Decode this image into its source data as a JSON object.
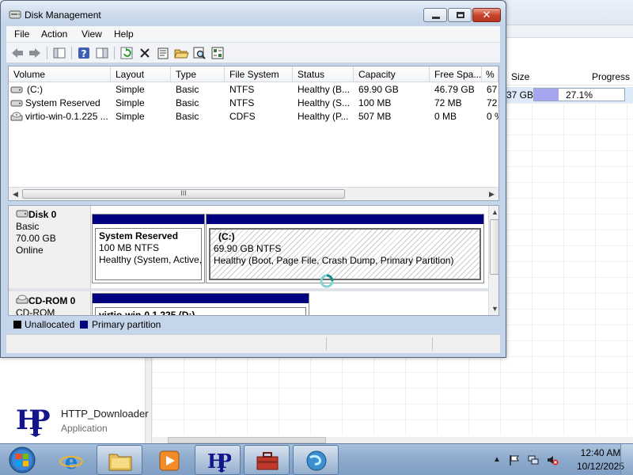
{
  "window": {
    "title": "Disk Management",
    "close_glyph": "✕"
  },
  "menu": {
    "file": "File",
    "action": "Action",
    "view": "View",
    "help": "Help"
  },
  "toolbar_icons": [
    "back-arrow-icon",
    "forward-arrow-icon",
    "console-tree-icon",
    "help-icon",
    "properties-pane-icon",
    "refresh-icon",
    "delete-icon",
    "properties-icon",
    "open-folder-icon",
    "search-icon",
    "settings-icon"
  ],
  "volume_list": {
    "columns": [
      "Volume",
      "Layout",
      "Type",
      "File System",
      "Status",
      "Capacity",
      "Free Spa...",
      "% F"
    ],
    "rows": [
      {
        "volume": "(C:)",
        "layout": "Simple",
        "type": "Basic",
        "fs": "NTFS",
        "status": "Healthy (B...",
        "capacity": "69.90 GB",
        "free": "46.79 GB",
        "pct": "67"
      },
      {
        "volume": "System Reserved",
        "layout": "Simple",
        "type": "Basic",
        "fs": "NTFS",
        "status": "Healthy (S...",
        "capacity": "100 MB",
        "free": "72 MB",
        "pct": "72"
      },
      {
        "volume": "virtio-win-0.1.225 ...",
        "layout": "Simple",
        "type": "Basic",
        "fs": "CDFS",
        "status": "Healthy (P...",
        "capacity": "507 MB",
        "free": "0 MB",
        "pct": "0 %"
      }
    ],
    "scroll_grip": "III"
  },
  "disks": [
    {
      "name": "Disk 0",
      "kind": "Basic",
      "size": "70.00 GB",
      "state": "Online",
      "partitions": [
        {
          "name": "System Reserved",
          "size": "100 MB NTFS",
          "status": "Healthy (System, Active,"
        },
        {
          "name": "(C:)",
          "size": "69.90 GB NTFS",
          "status": "Healthy (Boot, Page File, Crash Dump, Primary Partition)"
        }
      ]
    },
    {
      "name": "CD-ROM 0",
      "kind": "CD-ROM",
      "partitions": [
        {
          "name": "virtio-win-0.1.225  (D:)"
        }
      ]
    }
  ],
  "legend": {
    "unallocated": "Unallocated",
    "primary": "Primary partition",
    "unallocated_color": "#000000",
    "primary_color": "#000080"
  },
  "background": {
    "col_size": "Size",
    "col_progress": "Progress",
    "row_size": "37 GB",
    "progress_pct": 27.1,
    "progress_text": "27.1%",
    "app_name": "HTTP_Downloader",
    "app_type": "Application"
  },
  "taskbar": {
    "apps": [
      "internet-explorer",
      "windows-explorer",
      "media-player",
      "http-downloader",
      "toolbox",
      "network-app"
    ],
    "time": "12:40 AM",
    "date": "10/12/2025"
  }
}
